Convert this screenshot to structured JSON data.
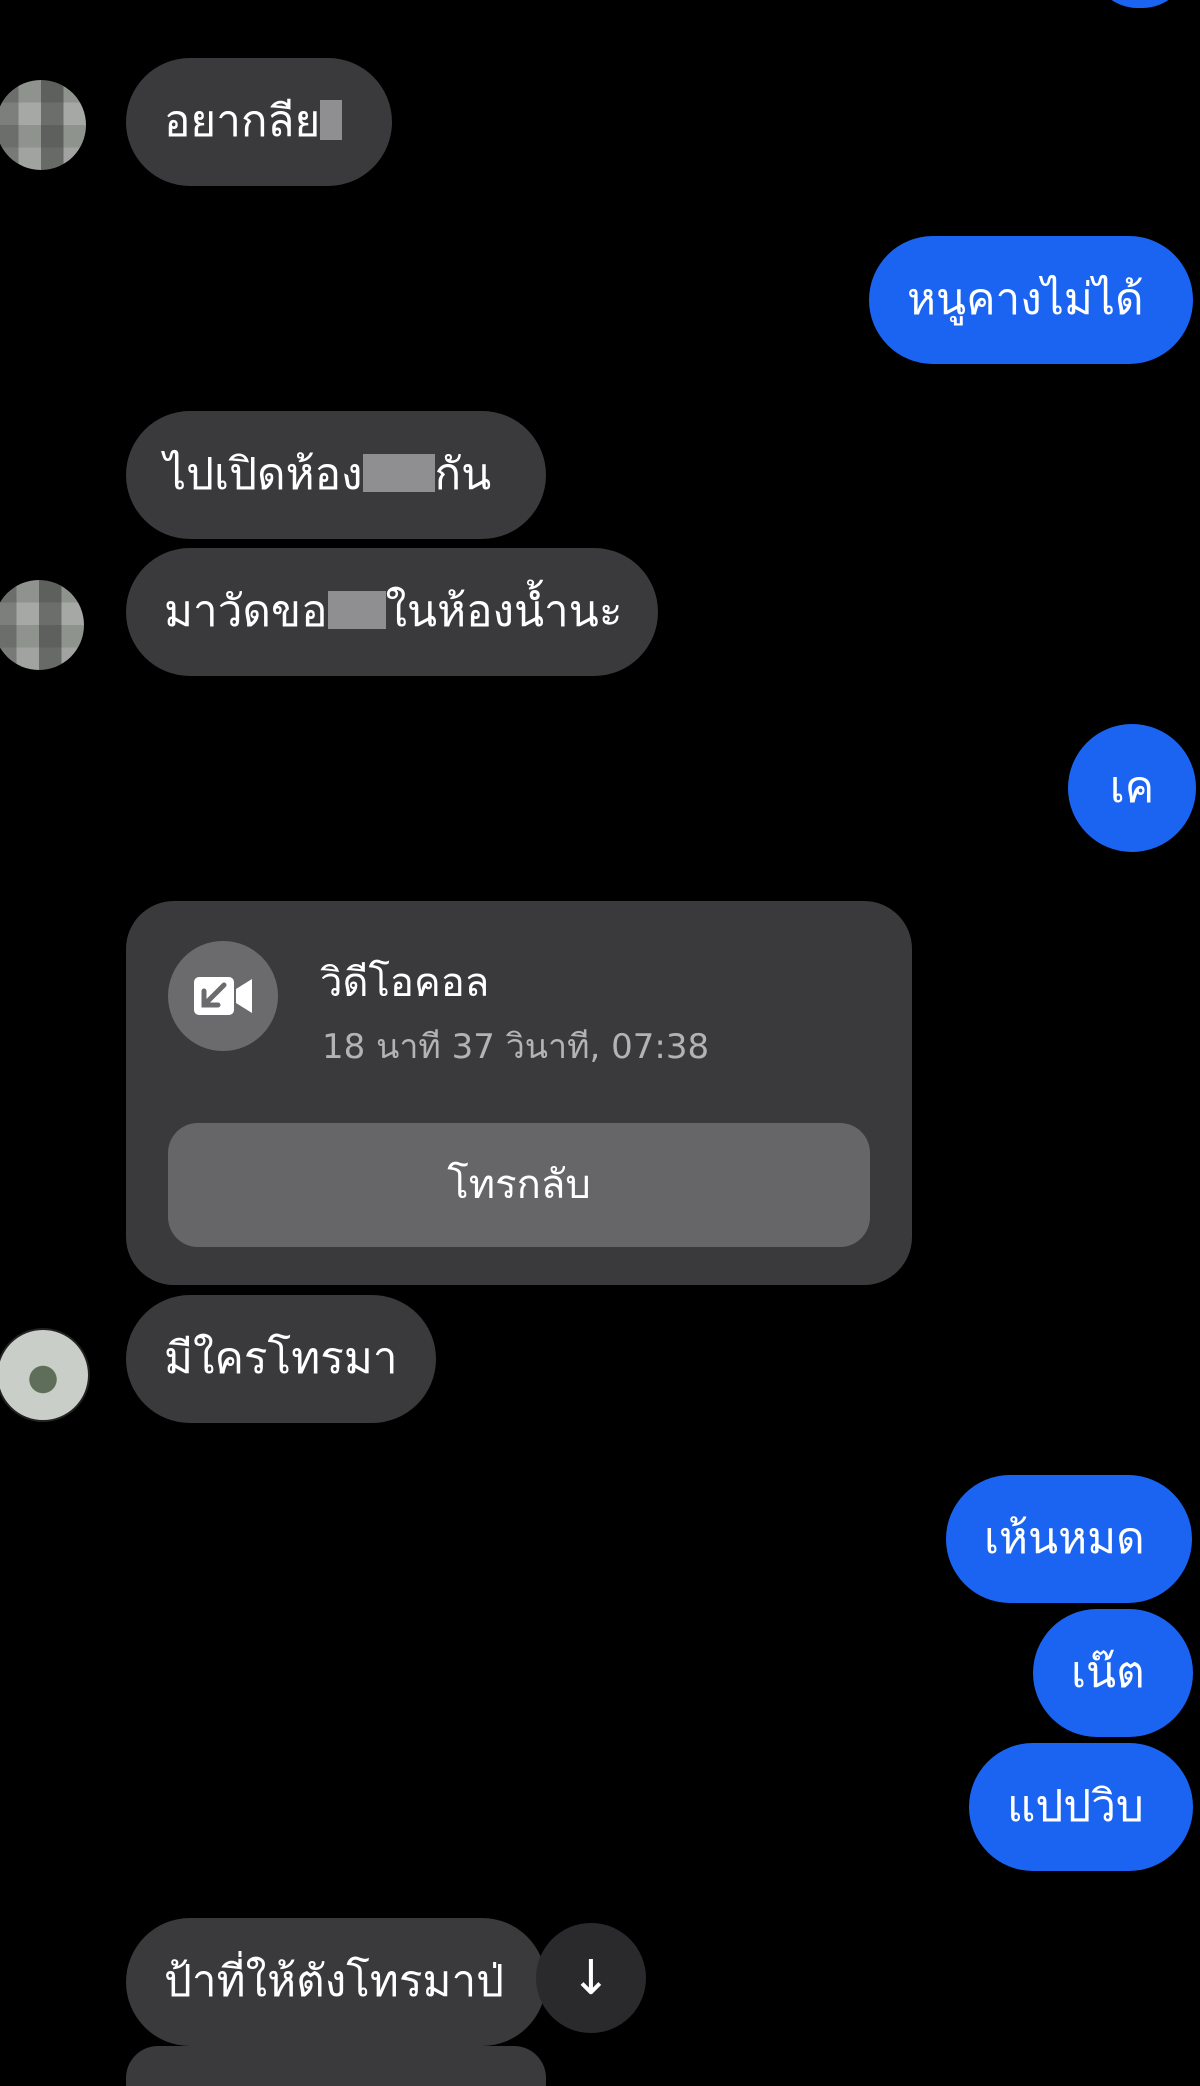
{
  "messages": {
    "m1": {
      "pre": "อยากลีย",
      "post": ""
    },
    "m2": "หนูคางไม่ได้",
    "m3": {
      "pre": "ไปเปิดห้อง",
      "post": "กัน"
    },
    "m4": {
      "pre": "มาวัดขอ",
      "post": "ในห้องน้ำนะ"
    },
    "m5": "เค",
    "m6": "มีใครโทรมา",
    "m7": "เห้นหมด",
    "m8": "เน๊ต",
    "m9": "แปปวิบ",
    "m10": "ป้าที่ให้ตังโทรมาป่"
  },
  "video_call": {
    "title": "วิดีโอคอล",
    "detail": "18 นาที 37 วินาที, 07:38",
    "callback_label": "โทรกลับ",
    "icon": "video-call-icon"
  },
  "scroll_down_icon": "↓",
  "colors": {
    "background": "#000000",
    "incoming_bubble": "#3a3a3c",
    "outgoing_bubble": "#1b64f2",
    "callback_button": "#666669"
  }
}
